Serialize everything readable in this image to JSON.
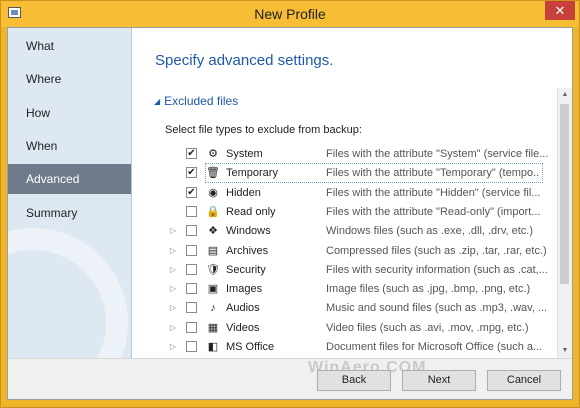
{
  "window": {
    "title": "New Profile",
    "close_label": "✕"
  },
  "sidebar": {
    "items": [
      {
        "label": "What",
        "active": false
      },
      {
        "label": "Where",
        "active": false
      },
      {
        "label": "How",
        "active": false
      },
      {
        "label": "When",
        "active": false
      },
      {
        "label": "Advanced",
        "active": true
      },
      {
        "label": "Summary",
        "active": false
      }
    ]
  },
  "main": {
    "heading": "Specify advanced settings.",
    "section_title": "Excluded files",
    "instruction": "Select file types to exclude from backup:",
    "file_types": [
      {
        "name": "System",
        "description": "Files with the attribute \"System\" (service file...",
        "checked": true,
        "expandable": false,
        "icon": "system-file-icon",
        "focused": false
      },
      {
        "name": "Temporary",
        "description": "Files with the attribute \"Temporary\" (tempo...",
        "checked": true,
        "expandable": false,
        "icon": "temporary-file-icon",
        "focused": true
      },
      {
        "name": "Hidden",
        "description": "Files with the attribute \"Hidden\" (service fil...",
        "checked": true,
        "expandable": false,
        "icon": "hidden-file-icon",
        "focused": false
      },
      {
        "name": "Read only",
        "description": "Files with the attribute \"Read-only\" (import...",
        "checked": false,
        "expandable": false,
        "icon": "lock-icon",
        "focused": false
      },
      {
        "name": "Windows",
        "description": "Windows files (such as .exe, .dll, .drv, etc.)",
        "checked": false,
        "expandable": true,
        "icon": "windows-logo-icon",
        "focused": false
      },
      {
        "name": "Archives",
        "description": "Compressed files (such as .zip, .tar, .rar, etc.)",
        "checked": false,
        "expandable": true,
        "icon": "archive-icon",
        "focused": false
      },
      {
        "name": "Security",
        "description": "Files with security information (such as .cat,...",
        "checked": false,
        "expandable": true,
        "icon": "security-icon",
        "focused": false
      },
      {
        "name": "Images",
        "description": "Image files (such as .jpg, .bmp, .png, etc.)",
        "checked": false,
        "expandable": true,
        "icon": "image-icon",
        "focused": false
      },
      {
        "name": "Audios",
        "description": "Music and sound files (such as .mp3, .wav, ...",
        "checked": false,
        "expandable": true,
        "icon": "audio-icon",
        "focused": false
      },
      {
        "name": "Videos",
        "description": "Video files (such as .avi, .mov, .mpg, etc.)",
        "checked": false,
        "expandable": true,
        "icon": "video-icon",
        "focused": false
      },
      {
        "name": "MS Office",
        "description": "Document files for Microsoft Office (such a...",
        "checked": false,
        "expandable": true,
        "icon": "ms-office-icon",
        "focused": false
      }
    ]
  },
  "footer": {
    "back_label": "Back",
    "next_label": "Next",
    "cancel_label": "Cancel",
    "watermark": "WinAero.COM"
  },
  "colors": {
    "accent": "#1e5aa8",
    "titlebar": "#f6bd35",
    "close": "#c7403a",
    "sidebar": "#dde8f3",
    "active_nav": "#6d7b8a"
  }
}
